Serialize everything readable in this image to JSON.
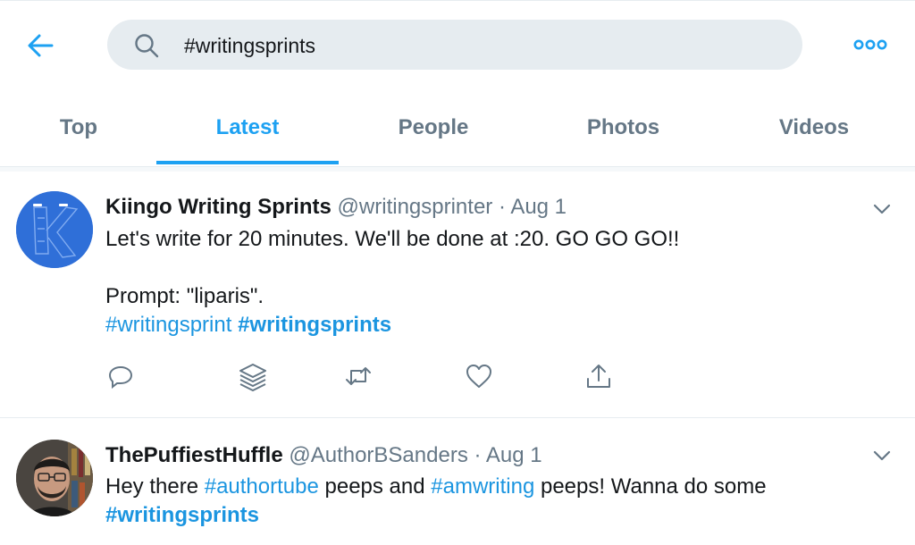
{
  "search": {
    "value": "#writingsprints"
  },
  "tabs": [
    {
      "label": "Top",
      "active": false
    },
    {
      "label": "Latest",
      "active": true
    },
    {
      "label": "People",
      "active": false
    },
    {
      "label": "Photos",
      "active": false
    },
    {
      "label": "Videos",
      "active": false
    }
  ],
  "tweets": [
    {
      "name": "Kiingo Writing Sprints",
      "handle": "@writingsprinter",
      "separator": "·",
      "date": "Aug 1",
      "line1": "Let's write for 20 minutes. We'll be done at :20. GO GO GO!!",
      "line2": "Prompt: \"liparis\".",
      "hashtag1": "#writingsprint",
      "hashtag2": "#writingsprints"
    },
    {
      "name": "ThePuffiestHuffle",
      "handle": "@AuthorBSanders",
      "separator": "·",
      "date": "Aug 1",
      "text_part1": "Hey there ",
      "hashtag1": "#authortube",
      "text_part2": " peeps and ",
      "hashtag2": "#amwriting",
      "text_part3": " peeps! Wanna do some",
      "hashtag3": "#writingsprints"
    }
  ],
  "colors": {
    "accent": "#1da1f2",
    "link": "#1b95e0",
    "muted": "#657786",
    "search_bg": "#e6ecf0"
  },
  "icons": [
    "back-arrow-icon",
    "search-icon",
    "more-icon",
    "chevron-down-icon",
    "reply-icon",
    "stack-icon",
    "retweet-icon",
    "like-icon",
    "share-icon"
  ]
}
